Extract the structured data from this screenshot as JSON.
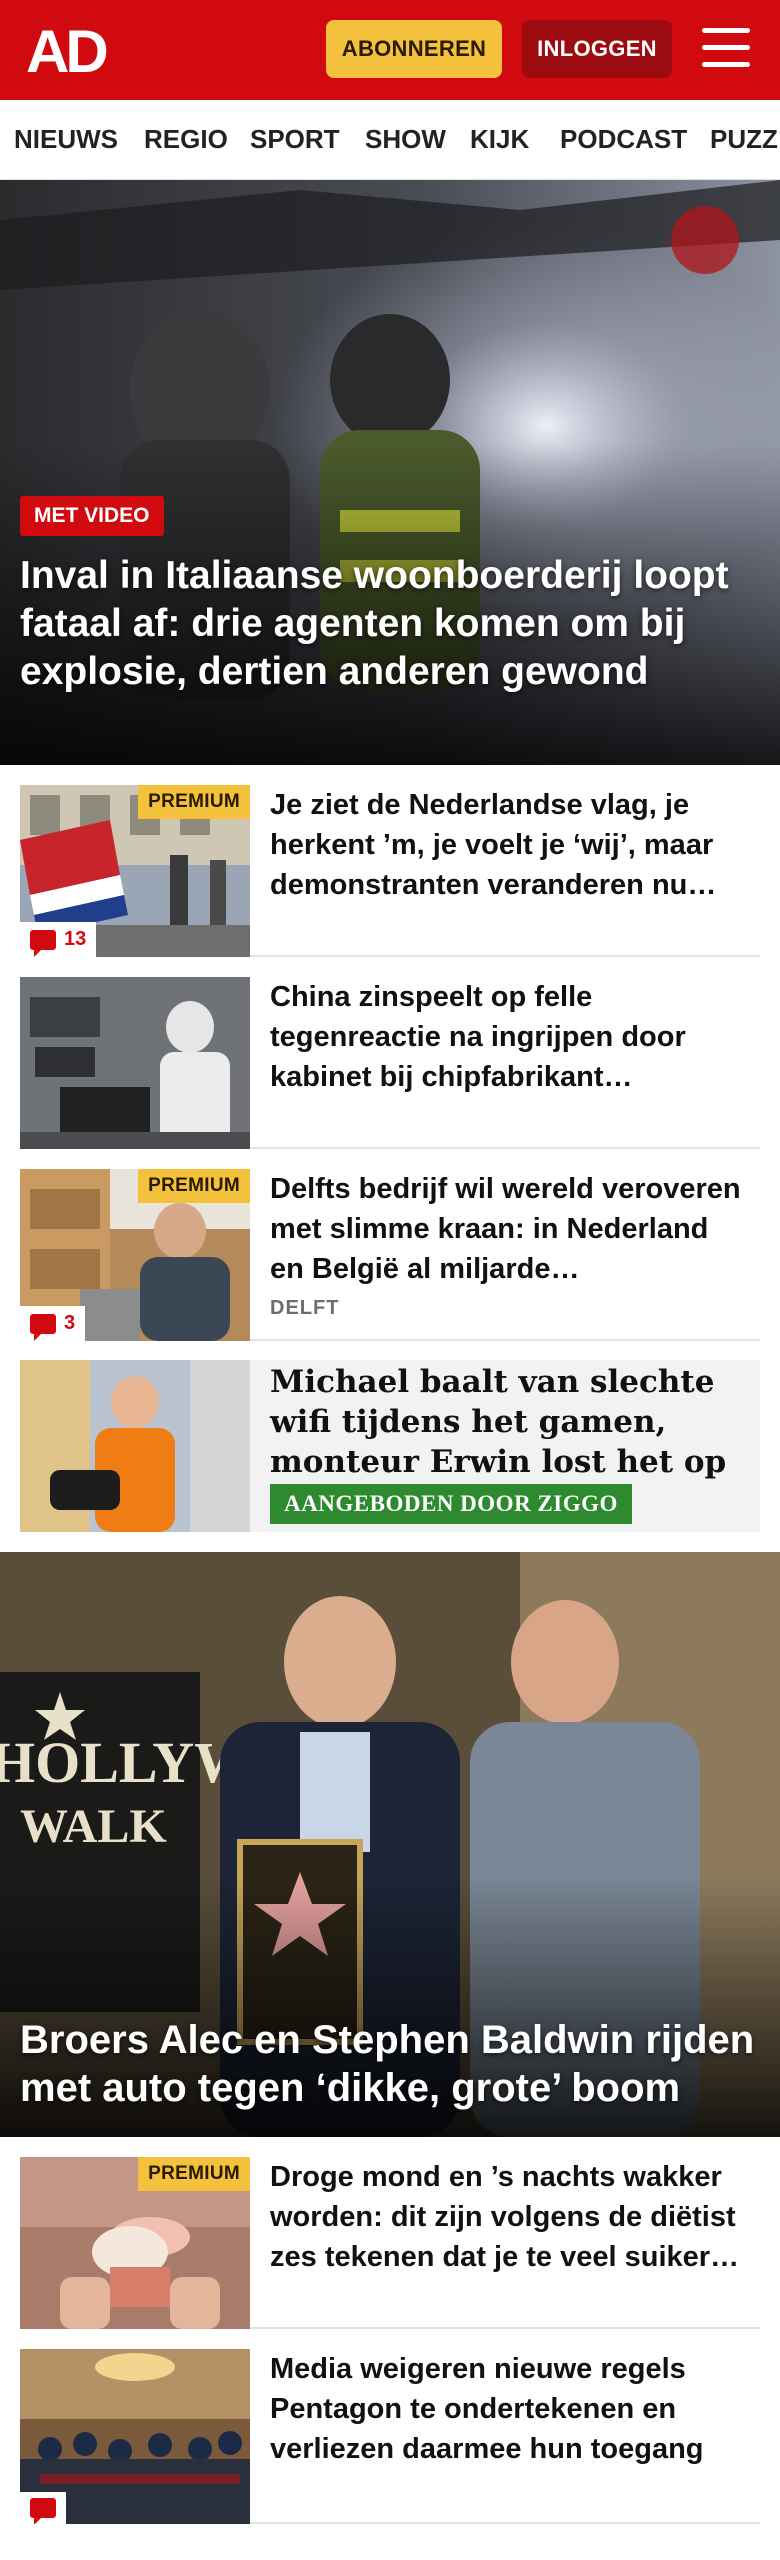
{
  "header": {
    "logo_text": "AD",
    "subscribe_label": "ABONNEREN",
    "login_label": "INLOGGEN",
    "brand_color": "#d10a10",
    "menu_icon": "hamburger-icon"
  },
  "nav": {
    "items": [
      "NIEUWS",
      "REGIO",
      "SPORT",
      "SHOW",
      "KIJK",
      "PODCAST",
      "PUZZ"
    ]
  },
  "hero1": {
    "badge": "MET VIDEO",
    "title": "Inval in Italiaanse woonboerderij loopt fataal af: drie agenten komen om bij explosie, dertien anderen gewond"
  },
  "articles": [
    {
      "title": "Je ziet de Nederlandse vlag, je herkent ’m, je voelt je ‘wij’, maar demonstranten veranderen nu…",
      "premium": "PREMIUM",
      "comments": "13"
    },
    {
      "title": "China zinspeelt op felle tegenreactie na ingrijpen door kabinet bij chipfabrikant…"
    },
    {
      "title": "Delfts bedrijf wil wereld veroveren met slimme kraan: in Nederland en België al miljarde…",
      "premium": "PREMIUM",
      "comments": "3",
      "tag": "DELFT"
    }
  ],
  "ad": {
    "title": "Michael baalt van slechte wifi tijdens het gamen, monteur Erwin lost het op",
    "label": "AANGEBODEN DOOR ZIGGO"
  },
  "hero2": {
    "title": "Broers Alec en Stephen Baldwin rijden met auto tegen ‘dikke, grote’ boom"
  },
  "articles2": [
    {
      "title": "Droge mond en ’s nachts wakker worden: dit zijn volgens de diëtist zes tekenen dat je te veel suiker…",
      "premium": "PREMIUM"
    },
    {
      "title": "Media weigeren nieuwe regels Pentagon te ondertekenen en verliezen daarmee hun toegang"
    }
  ]
}
